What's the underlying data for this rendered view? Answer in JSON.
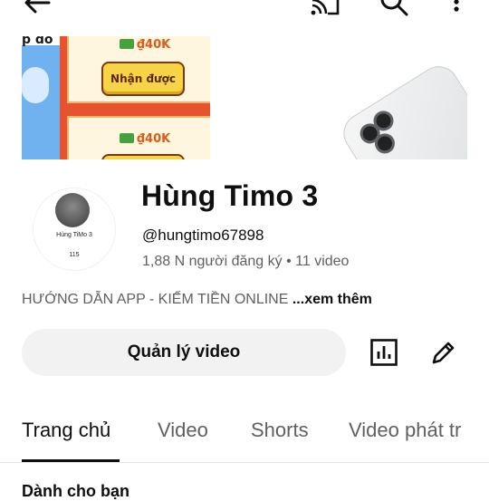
{
  "top_bar": {
    "icons": [
      "back-arrow-icon",
      "cast-icon",
      "search-icon",
      "more-vertical-icon"
    ]
  },
  "banner": {
    "corner_text": "p đô",
    "reward_amount_1": "₫40K",
    "claim_button_label": "Nhận được",
    "reward_amount_2": "₫40K"
  },
  "avatar": {
    "mini_name": "Hùng TiMo 3",
    "mini_count": "115"
  },
  "channel": {
    "name": "Hùng Timo 3",
    "handle": "@hungtimo67898",
    "subscribers": "1,88 N người đăng ký",
    "separator": "•",
    "video_count": "11 video",
    "description": "HƯỚNG DẪN APP - KIẾM TIỀN ONLINE",
    "see_more": " ...xem thêm"
  },
  "actions": {
    "manage_videos_label": "Quản lý video",
    "analytics_icon": "analytics-icon",
    "edit_icon": "edit-pencil-icon"
  },
  "tabs": [
    {
      "label": "Trang chủ",
      "active": true
    },
    {
      "label": "Video",
      "active": false
    },
    {
      "label": "Shorts",
      "active": false
    },
    {
      "label": "Video phát tr",
      "active": false
    }
  ],
  "section": {
    "heading_partial": "Dành cho bạn"
  },
  "colors": {
    "text_primary": "#0f0f0f",
    "text_secondary": "#606060",
    "button_bg": "#f2f2f2",
    "banner_orange": "#e8532f",
    "banner_blue": "#6fb2ef"
  }
}
